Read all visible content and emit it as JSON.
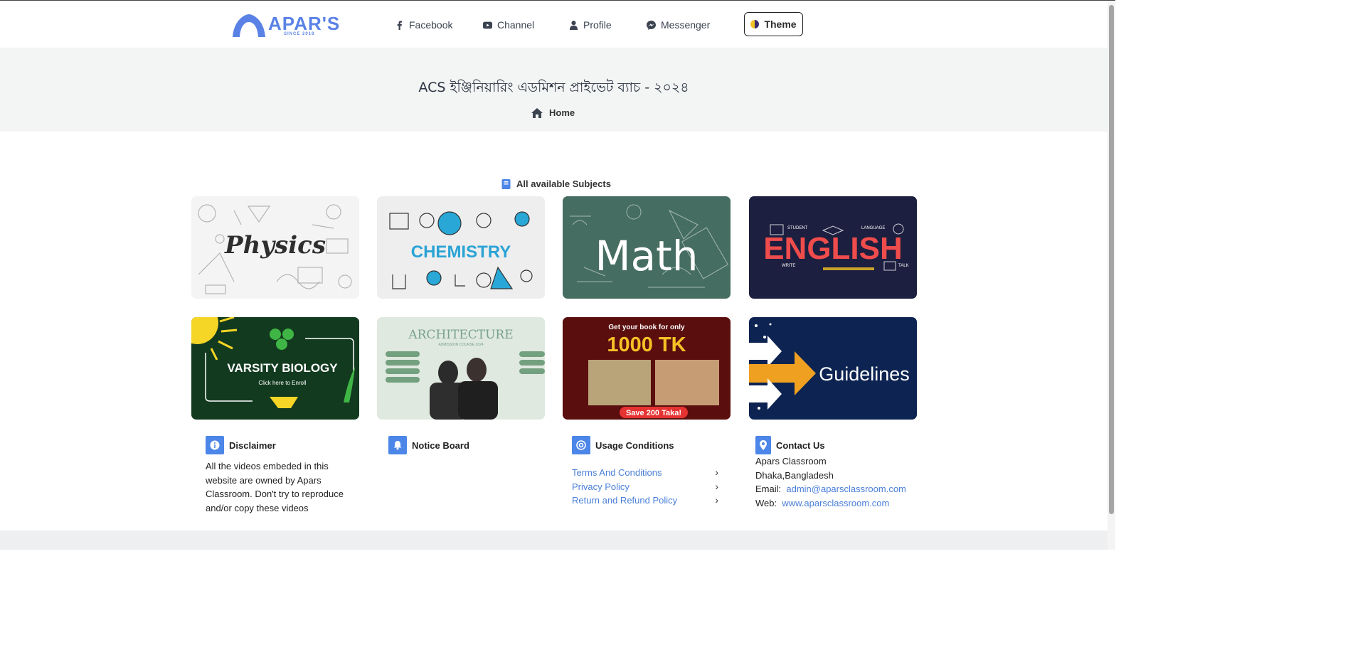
{
  "nav": {
    "logo_text": "APAR'S",
    "logo_since": "SINCE 2018",
    "links": [
      {
        "label": "Facebook",
        "icon": "facebook-icon"
      },
      {
        "label": "Channel",
        "icon": "youtube-icon"
      },
      {
        "label": "Profile",
        "icon": "user-icon"
      },
      {
        "label": "Messenger",
        "icon": "messenger-icon"
      }
    ],
    "theme_label": "Theme"
  },
  "hero": {
    "title": "ACS ইঞ্জিনিয়ারিং এডমিশন প্রাইভেট ব্যাচ - ২০২৪",
    "breadcrumb": "Home"
  },
  "subjects": {
    "heading": "All available Subjects",
    "cards": [
      {
        "name": "Physics",
        "text": "Physics"
      },
      {
        "name": "Chemistry",
        "text": "CHEMISTRY"
      },
      {
        "name": "Math",
        "text": "Math"
      },
      {
        "name": "English",
        "text": "ENGLISH",
        "small": [
          "STUDENT",
          "LANGUAGE",
          "WRITE",
          "TALK"
        ]
      },
      {
        "name": "Varsity Biology",
        "text": "VARSITY BIOLOGY",
        "sub": "Click here to Enroll"
      },
      {
        "name": "Architecture",
        "text": "ARCHITECTURE",
        "sub": "ADMISSION COURSE 2024"
      },
      {
        "name": "Book Offer",
        "text": "1000 TK",
        "top": "Get your book for only",
        "bottom": "Save 200 Taka!"
      },
      {
        "name": "Guidelines",
        "text": "Guidelines"
      }
    ]
  },
  "footer": {
    "disclaimer": {
      "title": "Disclaimer",
      "lines": [
        "All the videos embeded in this",
        "website are owned by Apars",
        "Classroom. Don't try to reproduce",
        "and/or copy these videos"
      ]
    },
    "notice": {
      "title": "Notice Board"
    },
    "usage": {
      "title": "Usage Conditions",
      "links": [
        "Terms And Conditions",
        "Privacy Policy",
        "Return and Refund Policy"
      ]
    },
    "contact": {
      "title": "Contact Us",
      "name": "Apars Classroom",
      "address": "Dhaka,Bangladesh",
      "email_label": "Email:",
      "email": "admin@aparsclassroom.com",
      "web_label": "Web:",
      "web": "www.aparsclassroom.com"
    }
  },
  "colors": {
    "brand": "#5a82e6",
    "link": "#4a7fd9",
    "icon_bg": "#4c86e8",
    "hero_bg": "#f3f4f4"
  }
}
